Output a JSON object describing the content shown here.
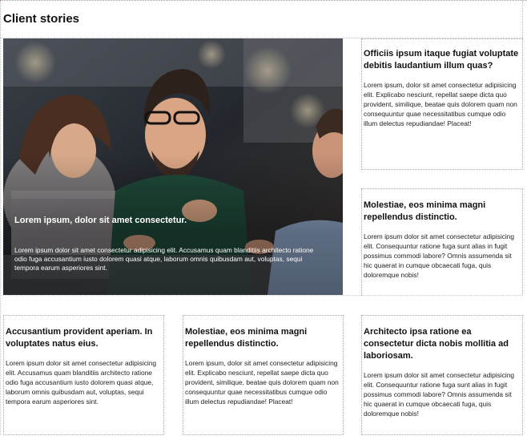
{
  "section": {
    "title": "Client stories"
  },
  "featured": {
    "image": "people-meeting-photo",
    "heading": "Lorem ipsum, dolor sit amet consectetur.",
    "text": "Lorem ipsum dolor sit amet consectetur adipisicing elit. Accusamus quam blanditiis architecto ratione odio fuga accusantium iusto dolorem quasi atque, laborum omnis quibusdam aut, voluptas, sequi tempora earum asperiores sint."
  },
  "stories": [
    {
      "heading": "Officiis ipsum itaque fugiat voluptate debitis laudantium illum quas?",
      "text": "Lorem ipsum, dolor sit amet consectetur adipisicing elit. Explicabo nesciunt, repellat saepe dicta quo provident, similique, beatae quis dolorem quam non consequuntur quae necessitatibus cumque odio illum delectus repudiandae! Placeat!"
    },
    {
      "heading": "Molestiae, eos minima magni repellendus distinctio.",
      "text": "Lorem ipsum dolor sit amet consectetur adipisicing elit. Consequuntur ratione fuga sunt alias in fugit possimus commodi labore? Omnis assumenda sit hic quaerat in cumque obcaecati fuga, quis doloremque nobis!"
    },
    {
      "heading": "Accusantium provident aperiam. In voluptates natus eius.",
      "text": "Lorem ipsum dolor sit amet consectetur adipisicing elit. Accusamus quam blanditiis architecto ratione odio fuga accusantium iusto dolorem quasi atque, laborum omnis quibusdam aut, voluptas, sequi tempora earum asperiores sint."
    },
    {
      "heading": "Molestiae, eos minima magni repellendus distinctio.",
      "text": "Lorem ipsum, dolor sit amet consectetur adipisicing elit. Explicabo nesciunt, repellat saepe dicta quo provident, similique, beatae quis dolorem quam non consequuntur quae necessitatibus cumque odio illum delectus repudiandae! Placeat!"
    },
    {
      "heading": "Architecto ipsa ratione ea consectetur dicta nobis mollitia ad laboriosam.",
      "text": "Lorem ipsum dolor sit amet consectetur adipisicing elit. Consequuntur ratione fuga sunt alias in fugit possimus commodi labore? Omnis assumenda sit hic quaerat in cumque obcaecati fuga, quis doloremque nobis!"
    }
  ]
}
